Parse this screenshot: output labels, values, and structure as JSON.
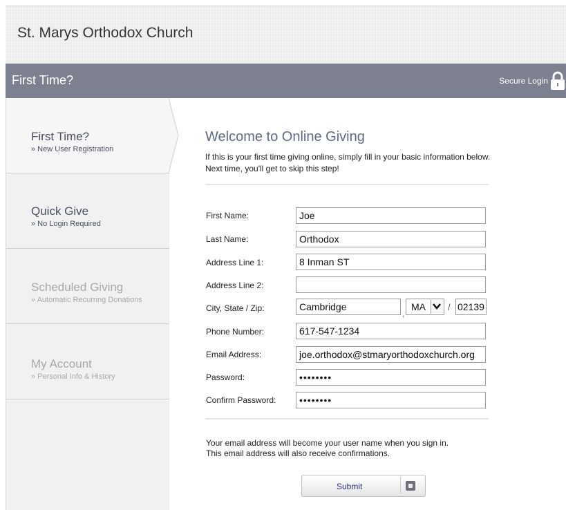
{
  "header": {
    "church_name": "St. Marys Orthodox Church"
  },
  "navbar": {
    "title": "First Time?",
    "secure_login": "Secure Login",
    "lock_icon": "lock-icon"
  },
  "sidebar": {
    "items": [
      {
        "title": "First Time?",
        "subtitle": "» New User Registration",
        "active": true
      },
      {
        "title": "Quick Give",
        "subtitle": "» No Login Required",
        "active": false
      },
      {
        "title": "Scheduled Giving",
        "subtitle": "» Automatic Recurring Donations",
        "active": false
      },
      {
        "title": "My Account",
        "subtitle": "» Personal Info & History",
        "active": false
      }
    ]
  },
  "main": {
    "heading": "Welcome to Online Giving",
    "intro_line1": "If this is your first time giving online, simply fill in your basic information below.",
    "intro_line2": "Next time, you'll get to skip this step!",
    "form": {
      "first_name_label": "First Name:",
      "first_name": "Joe",
      "last_name_label": "Last Name:",
      "last_name": "Orthodox",
      "address1_label": "Address Line 1:",
      "address1": "8 Inman ST",
      "address2_label": "Address Line 2:",
      "address2": "",
      "city_label": "City, State / Zip:",
      "city": "Cambridge",
      "state": "MA",
      "zip": "02139",
      "phone_label": "Phone Number:",
      "phone": "617-547-1234",
      "email_label": "Email Address:",
      "email": "joe.orthodox@stmaryorthodoxchurch.org",
      "password_label": "Password:",
      "password": "••••••••",
      "confirm_label": "Confirm Password:",
      "confirm_password": "••••••••"
    },
    "note_line1": "Your email address will become your user name when you sign in.",
    "note_line2": "This email address will also receive confirmations.",
    "submit_label": "Submit"
  },
  "colors": {
    "navbar": "#7d808f",
    "heading": "#5d6b86",
    "active_text": "#4a4f63",
    "inactive_text": "#a8a8a8"
  }
}
